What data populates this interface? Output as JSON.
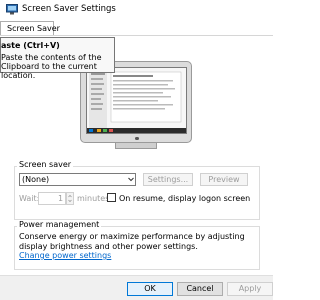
{
  "window": {
    "title": "Screen Saver Settings",
    "icon": "screen-saver-window-icon"
  },
  "tabs": [
    {
      "label": "Screen Saver",
      "active": true
    }
  ],
  "tooltip": {
    "title": "aste (Ctrl+V)",
    "description": "Paste the contents of the Clipboard to the current location."
  },
  "screen_saver": {
    "group_label": "Screen saver",
    "selected": "(None)",
    "settings_label": "Settings...",
    "preview_label": "Preview",
    "wait_label": "Wait:",
    "wait_value": "1",
    "minutes_label": "minutes",
    "resume_label": "On resume, display logon screen",
    "resume_checked": false
  },
  "power": {
    "group_label": "Power management",
    "description": "Conserve energy or maximize performance by adjusting display brightness and other power settings.",
    "link_text": "Change power settings"
  },
  "footer": {
    "ok_label": "OK",
    "cancel_label": "Cancel",
    "apply_label": "Apply"
  },
  "colors": {
    "link": "#0066cc",
    "accent": "#0078d7",
    "disabled_text": "#9c9c9c"
  }
}
